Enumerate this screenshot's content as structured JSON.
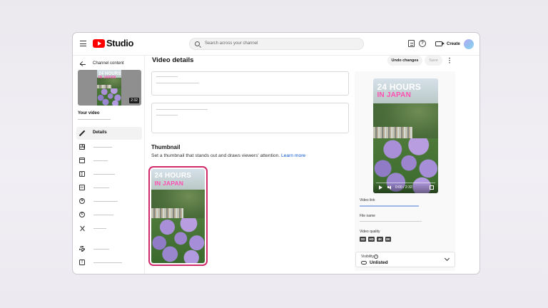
{
  "app": {
    "logo_text": "Studio",
    "search_placeholder": "Search across your channel",
    "create_label": "Create"
  },
  "sidebar": {
    "back_label": "Channel content",
    "video_duration": "2:32",
    "your_video_label": "Your video",
    "items": [
      {
        "label": "Details",
        "icon": "pencil-icon",
        "active": true
      },
      {
        "label": "",
        "icon": "analytics-icon"
      },
      {
        "label": "",
        "icon": "editor-icon"
      },
      {
        "label": "",
        "icon": "comments-icon"
      },
      {
        "label": "",
        "icon": "subtitles-icon"
      },
      {
        "label": "",
        "icon": "monetization-icon"
      },
      {
        "label": "",
        "icon": "copyright-icon"
      },
      {
        "label": "",
        "icon": "clips-icon"
      },
      {
        "label": "",
        "icon": "settings-icon"
      },
      {
        "label": "",
        "icon": "feedback-icon"
      }
    ]
  },
  "header": {
    "title": "Video details",
    "undo_label": "Undo changes",
    "save_label": "Save"
  },
  "thumbnail_section": {
    "title": "Thumbnail",
    "description": "Set a thumbnail that stands out and draws viewers' attention.",
    "learn_more": "Learn more"
  },
  "video_art": {
    "line1": "24 HOURS",
    "line2": "IN JAPAN"
  },
  "preview": {
    "time": "0:00 / 2:32",
    "video_link_label": "Video link",
    "file_name_label": "File name",
    "video_quality_label": "Video quality",
    "quality_badges": [
      "SD",
      "HD",
      "4K",
      "8K"
    ]
  },
  "visibility": {
    "label": "Visibility",
    "value": "Unlisted"
  },
  "colors": {
    "brand": "#ff0000",
    "selection_border": "#d12a6a",
    "link": "#0b57d0",
    "title_accent": "#ff4fb2"
  }
}
